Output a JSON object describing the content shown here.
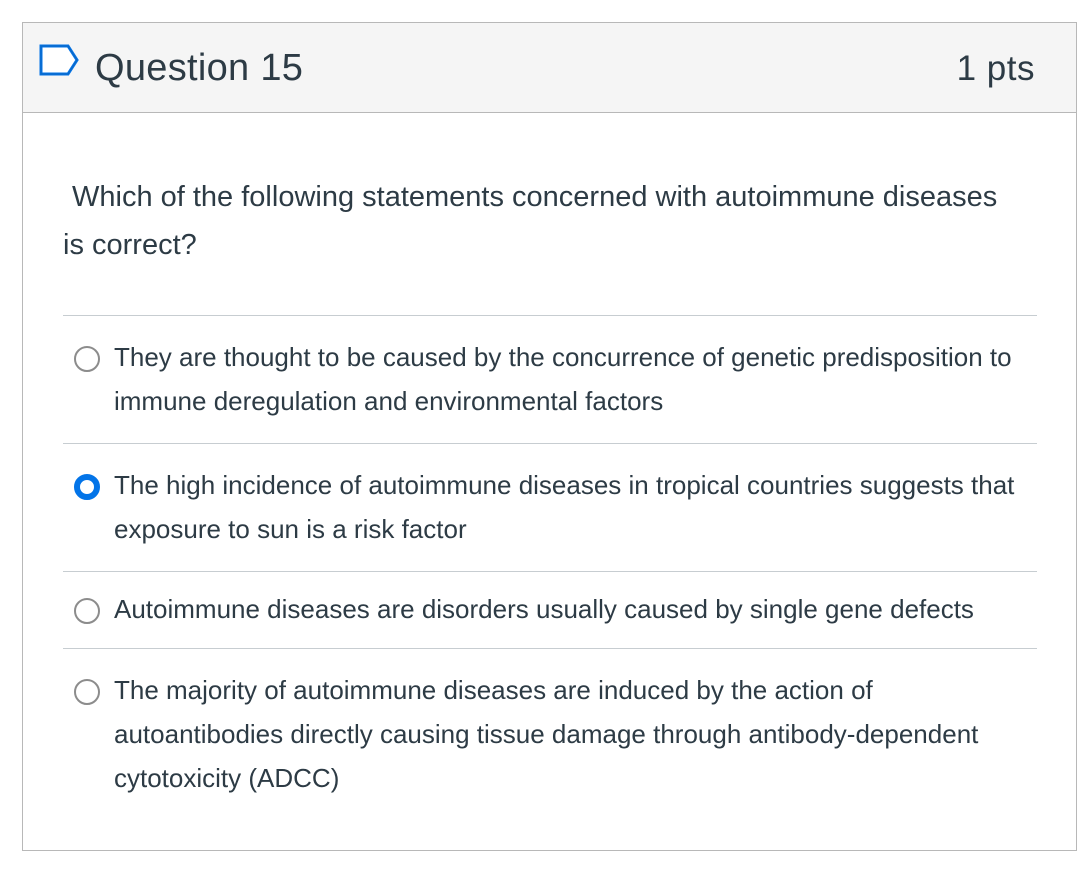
{
  "question": {
    "title": "Question 15",
    "points": "1 pts",
    "text": "Which of the following statements concerned with autoimmune diseases is correct?",
    "flag_icon": "flag-outline-icon",
    "accent_color": "#0374e8"
  },
  "answers": [
    {
      "label": "They are thought to be caused by the concurrence of genetic predisposition to immune deregulation and environmental factors",
      "selected": false
    },
    {
      "label": "The high incidence of autoimmune diseases in tropical countries suggests that exposure to sun is a risk factor",
      "selected": true
    },
    {
      "label": "Autoimmune diseases are disorders usually caused by single gene defects",
      "selected": false
    },
    {
      "label": "The majority of autoimmune diseases are induced by the action of autoantibodies directly causing tissue damage through antibody-dependent cytotoxicity (ADCC)",
      "selected": false
    }
  ]
}
